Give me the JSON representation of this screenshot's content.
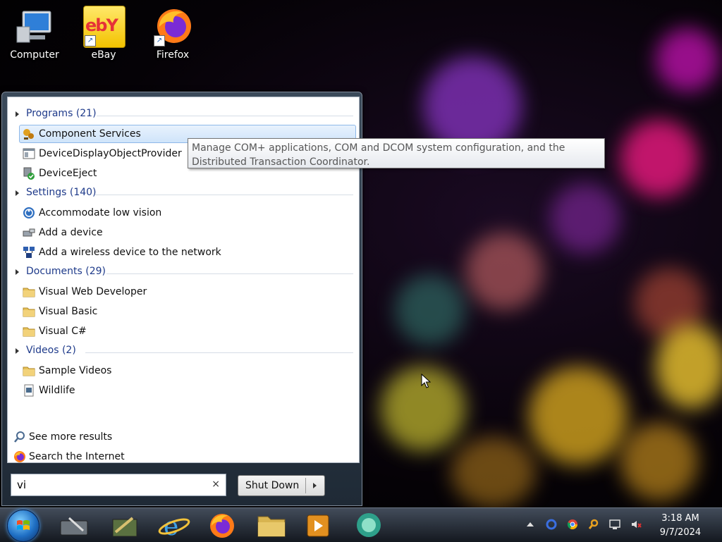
{
  "desktop": {
    "icons": [
      {
        "label": "Computer",
        "icon": "computer-icon"
      },
      {
        "label": "eBay",
        "icon": "ebay-icon",
        "logo_text": "ebY"
      },
      {
        "label": "Firefox",
        "icon": "firefox-icon"
      }
    ]
  },
  "start_menu": {
    "groups": [
      {
        "title": "Programs (21)",
        "items": [
          {
            "label": "Component Services",
            "icon": "component-services-icon",
            "selected": true
          },
          {
            "label": "DeviceDisplayObjectProvider",
            "icon": "app-window-icon"
          },
          {
            "label": "DeviceEject",
            "icon": "device-eject-icon"
          }
        ]
      },
      {
        "title": "Settings (140)",
        "items": [
          {
            "label": "Accommodate low vision",
            "icon": "ease-of-access-icon"
          },
          {
            "label": "Add a device",
            "icon": "add-device-icon"
          },
          {
            "label": "Add a wireless device to the network",
            "icon": "network-icon"
          }
        ]
      },
      {
        "title": "Documents (29)",
        "items": [
          {
            "label": "Visual Web Developer",
            "icon": "folder-icon"
          },
          {
            "label": "Visual Basic",
            "icon": "folder-icon"
          },
          {
            "label": "Visual C#",
            "icon": "folder-icon"
          }
        ]
      },
      {
        "title": "Videos (2)",
        "items": [
          {
            "label": "Sample Videos",
            "icon": "folder-icon"
          },
          {
            "label": "Wildlife",
            "icon": "video-file-icon"
          }
        ]
      }
    ],
    "see_more": "See more results",
    "search_internet": "Search the Internet",
    "search_value": "vi",
    "clear_glyph": "×",
    "shutdown_label": "Shut Down"
  },
  "tooltip": {
    "text": "Manage COM+ applications, COM and DCOM system configuration, and the Distributed Transaction Coordinator."
  },
  "taskbar": {
    "apps": [
      "pen-tablet-icon",
      "notepad-icon",
      "internet-explorer-icon",
      "firefox-icon",
      "file-explorer-icon",
      "media-player-icon",
      "messenger-icon"
    ],
    "tray": [
      "show-hidden-icons-arrow",
      "circle-app-icon",
      "chrome-icon",
      "search-tool-icon",
      "network-status-icon",
      "volume-muted-icon"
    ],
    "time": "3:18 AM",
    "date": "9/7/2024"
  }
}
